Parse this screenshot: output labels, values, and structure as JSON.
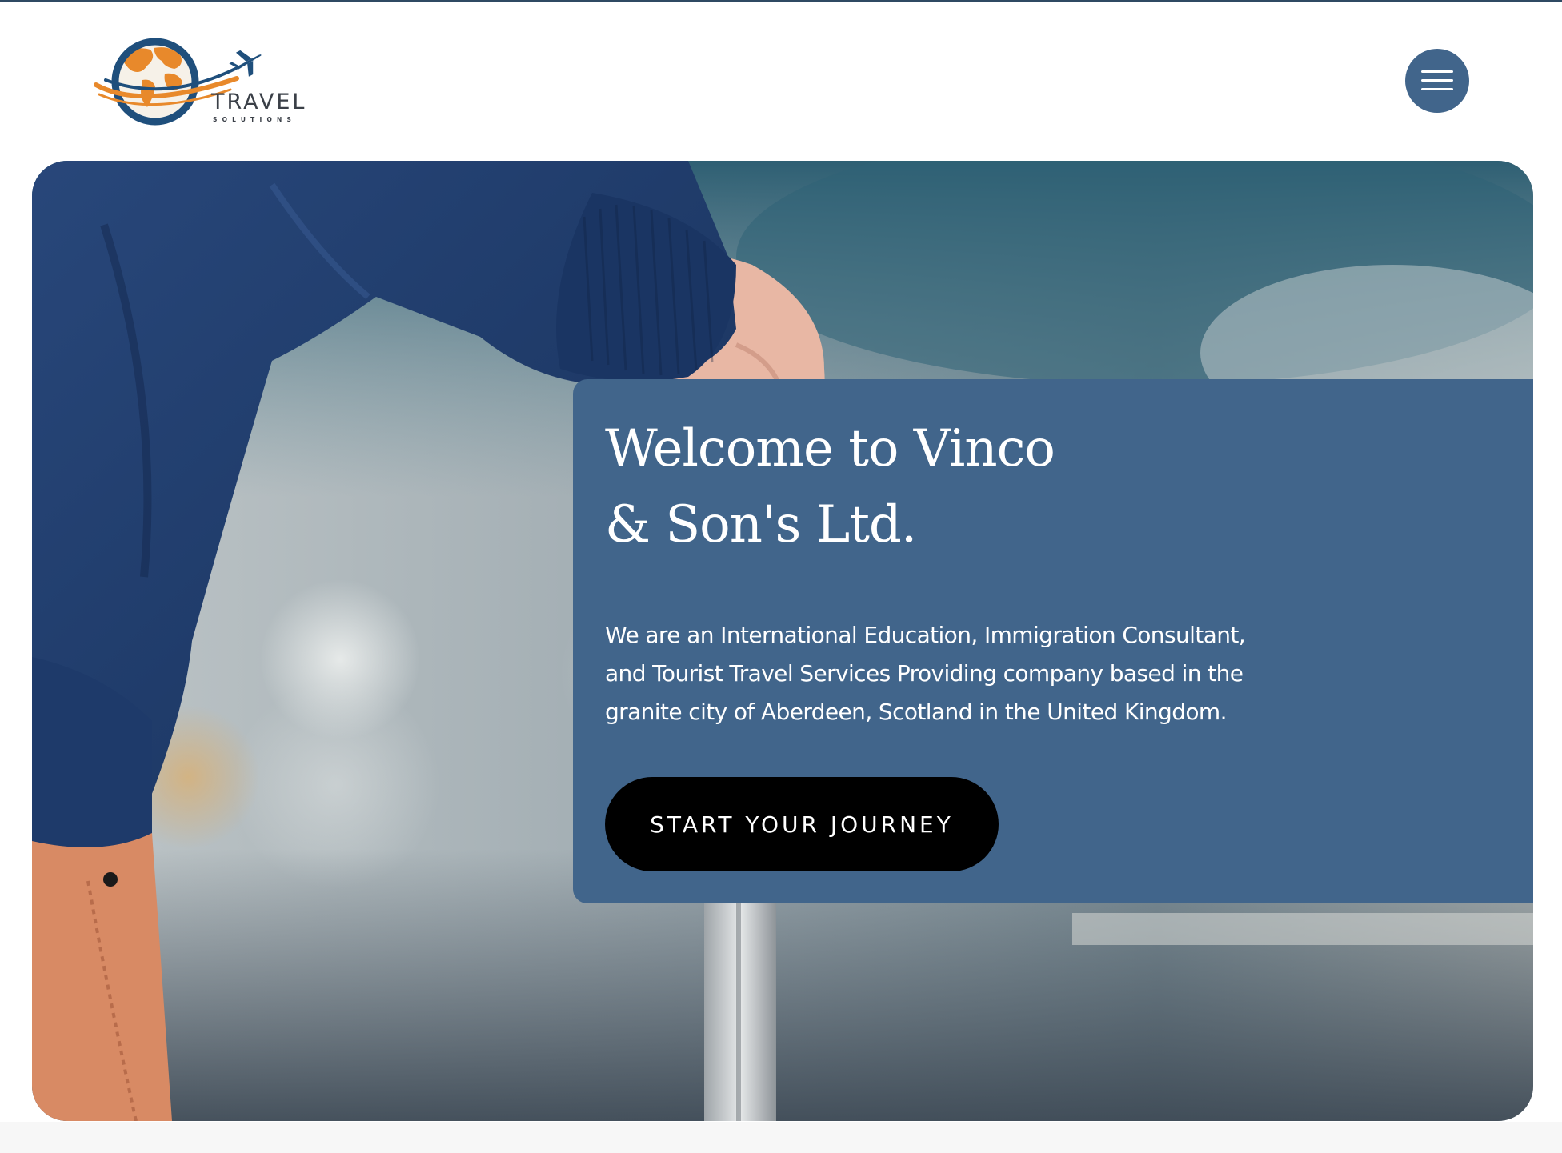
{
  "header": {
    "logo": {
      "wordmark": "TRAVEL",
      "tagline": "SOLUTIONS"
    },
    "menu_button_icon": "hamburger-menu-icon"
  },
  "hero": {
    "title_line1": "Welcome to Vinco",
    "title_line2": "& Son's Ltd.",
    "description": "We are an International Education, Immigration Consultant, and Tourist Travel Services Providing company based in the granite city of Aberdeen, Scotland in the United Kingdom.",
    "cta_label": "START YOUR JOURNEY"
  },
  "colors": {
    "brand_blue": "#41658b",
    "logo_orange": "#e8892b",
    "logo_navy": "#1f4f7c",
    "cta_black": "#000000",
    "text_white": "#ffffff"
  }
}
